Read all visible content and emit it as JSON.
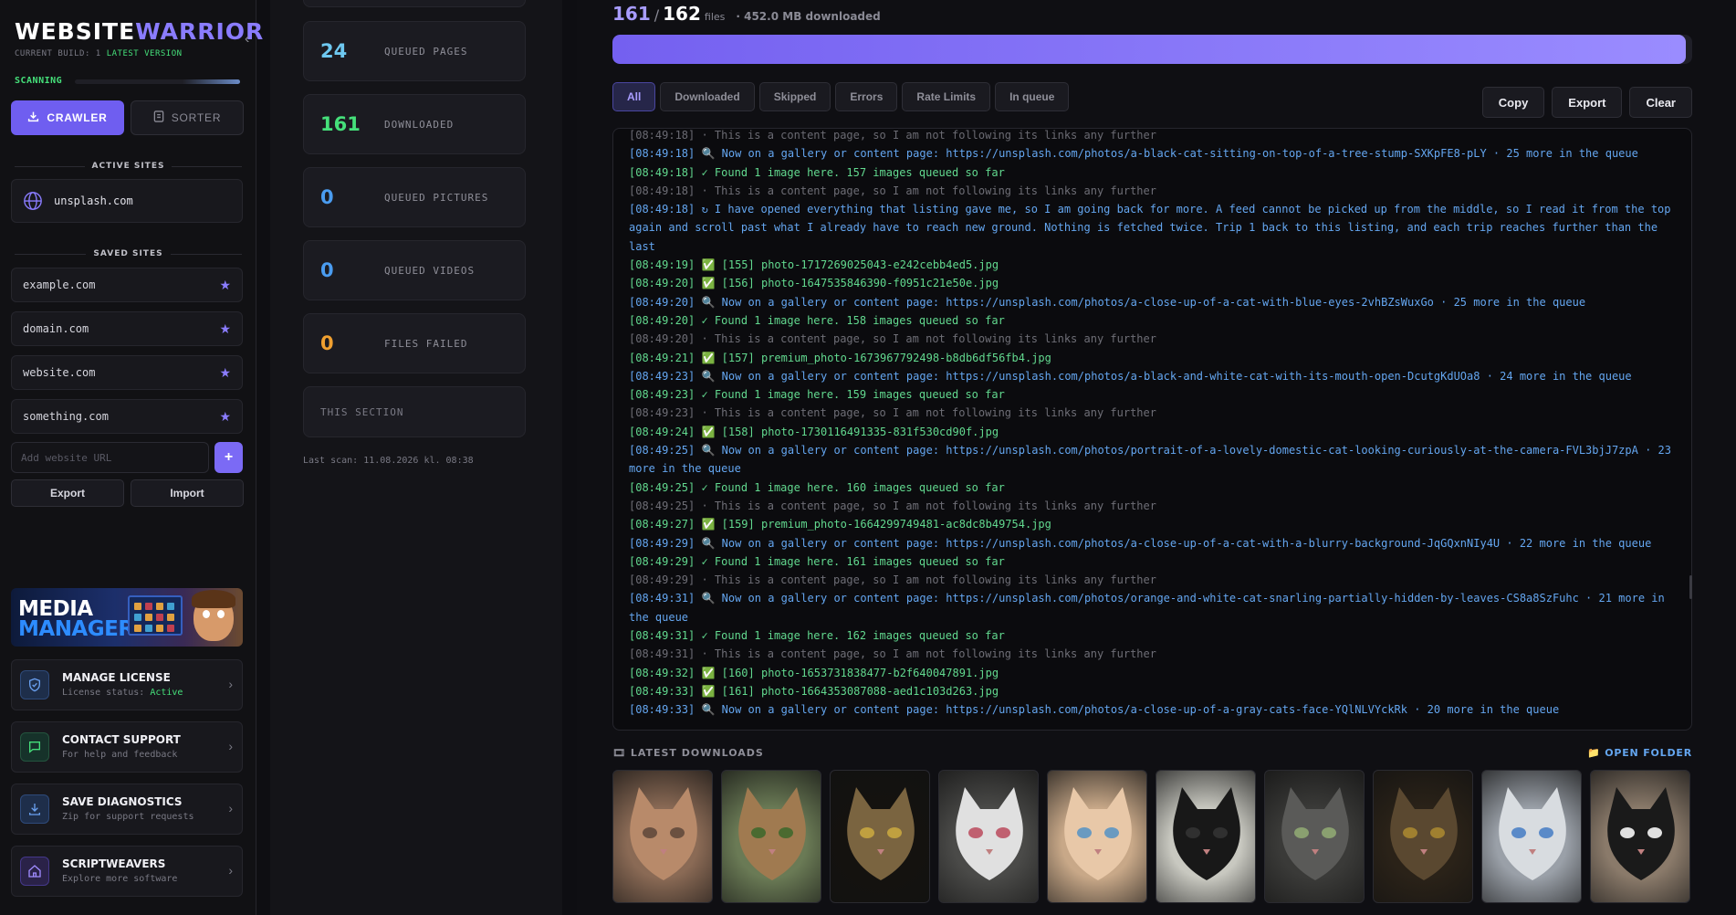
{
  "sidebar": {
    "brand_part1": "WEBSITE",
    "brand_part2": "WARRIOR",
    "build_label": "CURRENT BUILD: 1",
    "build_status": "LATEST VERSION",
    "scan_label": "SCANNING",
    "scan_progress": 0.35,
    "crawler_label": "CRAWLER",
    "sorter_label": "SORTER",
    "active_sites_heading": "ACTIVE SITES",
    "active_site": "unsplash.com",
    "saved_sites_heading": "SAVED SITES",
    "saved_sites": [
      {
        "label": "example.com"
      },
      {
        "label": "domain.com"
      },
      {
        "label": "website.com"
      },
      {
        "label": "something.com"
      }
    ],
    "add_placeholder": "Add website URL",
    "add_button": "+",
    "export_label": "Export",
    "import_label": "Import",
    "promo_line1": "MEDIA",
    "promo_line2": "MANAGER",
    "menu": [
      {
        "title": "MANAGE LICENSE",
        "sub_prefix": "License status: ",
        "sub_value": "Active",
        "icon": "shield-icon"
      },
      {
        "title": "CONTACT SUPPORT",
        "sub_prefix": "For help and feedback",
        "sub_value": "",
        "icon": "chat-icon"
      },
      {
        "title": "SAVE DIAGNOSTICS",
        "sub_prefix": "Zip for support requests",
        "sub_value": "",
        "icon": "download-icon"
      },
      {
        "title": "SCRIPTWEAVERS",
        "sub_prefix": "Explore more software",
        "sub_value": "",
        "icon": "home-icon"
      }
    ],
    "colors": {
      "accent": "#6f5ef0",
      "ok": "#45e07a"
    }
  },
  "stats": {
    "items": [
      {
        "value": "24",
        "label": "QUEUED PAGES",
        "color": "#6ec8f0"
      },
      {
        "value": "161",
        "label": "DOWNLOADED",
        "color": "#45e07a"
      },
      {
        "value": "0",
        "label": "QUEUED PICTURES",
        "color": "#4a9cf0"
      },
      {
        "value": "0",
        "label": "QUEUED VIDEOS",
        "color": "#4a9cf0"
      },
      {
        "value": "0",
        "label": "FILES FAILED",
        "color": "#f0a030"
      }
    ],
    "this_section": "THIS SECTION",
    "last_scan": "Last scan: 11.08.2026 kl. 08:38"
  },
  "main": {
    "count_done": "161",
    "count_sep": "/",
    "count_total": "162",
    "count_unit": "files",
    "downloaded_size": "· 452.0 MB downloaded",
    "progress": 0.9938,
    "filters": [
      "All",
      "Downloaded",
      "Skipped",
      "Errors",
      "Rate Limits",
      "In queue"
    ],
    "active_filter": "All",
    "actions": [
      "Copy",
      "Export",
      "Clear"
    ],
    "log_cut": "[08:49:18] · This is a content page, so I am not following its links any further",
    "log": [
      {
        "kind": "blue",
        "text": "[08:49:18] 🔍 Now on a gallery or content page: https://unsplash.com/photos/a-black-cat-sitting-on-top-of-a-tree-stump-SXKpFE8-pLY · 25 more in the queue"
      },
      {
        "kind": "green",
        "text": "[08:49:18] ✓ Found 1 image here. 157 images queued so far"
      },
      {
        "kind": "gray",
        "text": "[08:49:18] · This is a content page, so I am not following its links any further"
      },
      {
        "kind": "blue",
        "text": "[08:49:18] ↻ I have opened everything that listing gave me, so I am going back for more. A feed cannot be picked up from the middle, so I read it from the top again and scroll past what I already have to reach new ground. Nothing is fetched twice. Trip 1 back to this listing, and each trip reaches further than the last"
      },
      {
        "kind": "green",
        "text": "[08:49:19] ✅ [155] photo-1717269025043-e242cebb4ed5.jpg"
      },
      {
        "kind": "green",
        "text": "[08:49:20] ✅ [156] photo-1647535846390-f0951c21e50e.jpg"
      },
      {
        "kind": "blue",
        "text": "[08:49:20] 🔍 Now on a gallery or content page: https://unsplash.com/photos/a-close-up-of-a-cat-with-blue-eyes-2vhBZsWuxGo · 25 more in the queue"
      },
      {
        "kind": "green",
        "text": "[08:49:20] ✓ Found 1 image here. 158 images queued so far"
      },
      {
        "kind": "gray",
        "text": "[08:49:20] · This is a content page, so I am not following its links any further"
      },
      {
        "kind": "green",
        "text": "[08:49:21] ✅ [157] premium_photo-1673967792498-b8db6df56fb4.jpg"
      },
      {
        "kind": "blue",
        "text": "[08:49:23] 🔍 Now on a gallery or content page: https://unsplash.com/photos/a-black-and-white-cat-with-its-mouth-open-DcutgKdUOa8 · 24 more in the queue"
      },
      {
        "kind": "green",
        "text": "[08:49:23] ✓ Found 1 image here. 159 images queued so far"
      },
      {
        "kind": "gray",
        "text": "[08:49:23] · This is a content page, so I am not following its links any further"
      },
      {
        "kind": "green",
        "text": "[08:49:24] ✅ [158] photo-1730116491335-831f530cd90f.jpg"
      },
      {
        "kind": "blue",
        "text": "[08:49:25] 🔍 Now on a gallery or content page: https://unsplash.com/photos/portrait-of-a-lovely-domestic-cat-looking-curiously-at-the-camera-FVL3bjJ7zpA · 23 more in the queue"
      },
      {
        "kind": "green",
        "text": "[08:49:25] ✓ Found 1 image here. 160 images queued so far"
      },
      {
        "kind": "gray",
        "text": "[08:49:25] · This is a content page, so I am not following its links any further"
      },
      {
        "kind": "green",
        "text": "[08:49:27] ✅ [159] premium_photo-1664299749481-ac8dc8b49754.jpg"
      },
      {
        "kind": "blue",
        "text": "[08:49:29] 🔍 Now on a gallery or content page: https://unsplash.com/photos/a-close-up-of-a-cat-with-a-blurry-background-JqGQxnNIy4U · 22 more in the queue"
      },
      {
        "kind": "green",
        "text": "[08:49:29] ✓ Found 1 image here. 161 images queued so far"
      },
      {
        "kind": "gray",
        "text": "[08:49:29] · This is a content page, so I am not following its links any further"
      },
      {
        "kind": "blue",
        "text": "[08:49:31] 🔍 Now on a gallery or content page: https://unsplash.com/photos/orange-and-white-cat-snarling-partially-hidden-by-leaves-CS8a8SzFuhc · 21 more in the queue"
      },
      {
        "kind": "green",
        "text": "[08:49:31] ✓ Found 1 image here. 162 images queued so far"
      },
      {
        "kind": "gray",
        "text": "[08:49:31] · This is a content page, so I am not following its links any further"
      },
      {
        "kind": "green",
        "text": "[08:49:32] ✅ [160] photo-1653731838477-b2f640047891.jpg"
      },
      {
        "kind": "green",
        "text": "[08:49:33] ✅ [161] photo-1664353087088-aed1c103d263.jpg"
      },
      {
        "kind": "blue",
        "text": "[08:49:33] 🔍 Now on a gallery or content page: https://unsplash.com/photos/a-close-up-of-a-gray-cats-face-YQlNLVYckRk · 20 more in the queue"
      }
    ],
    "latest_heading": "LATEST DOWNLOADS",
    "open_folder": "OPEN FOLDER",
    "thumbnails": [
      {
        "bg": "#8a6a55",
        "fur": "#b88a6a",
        "eye": "#6a5040"
      },
      {
        "bg": "#6a7a55",
        "fur": "#a07a50",
        "eye": "#4a6a30"
      },
      {
        "bg": "#14120f",
        "fur": "#7a6440",
        "eye": "#c0a040"
      },
      {
        "bg": "#4a4a48",
        "fur": "#e0e0e0",
        "eye": "#c06070"
      },
      {
        "bg": "#c8a888",
        "fur": "#e8c8a8",
        "eye": "#6a9ac0"
      },
      {
        "bg": "#c8c8c0",
        "fur": "#181818",
        "eye": "#303030"
      },
      {
        "bg": "#3a3a38",
        "fur": "#5a5a58",
        "eye": "#8aa070"
      },
      {
        "bg": "#2a2218",
        "fur": "#5a4830",
        "eye": "#a08030"
      },
      {
        "bg": "#9aa0a8",
        "fur": "#d8dce0",
        "eye": "#5a8ac8"
      },
      {
        "bg": "#8a7a6a",
        "fur": "#1a1a1a",
        "eye": "#e0e0e0"
      }
    ]
  }
}
